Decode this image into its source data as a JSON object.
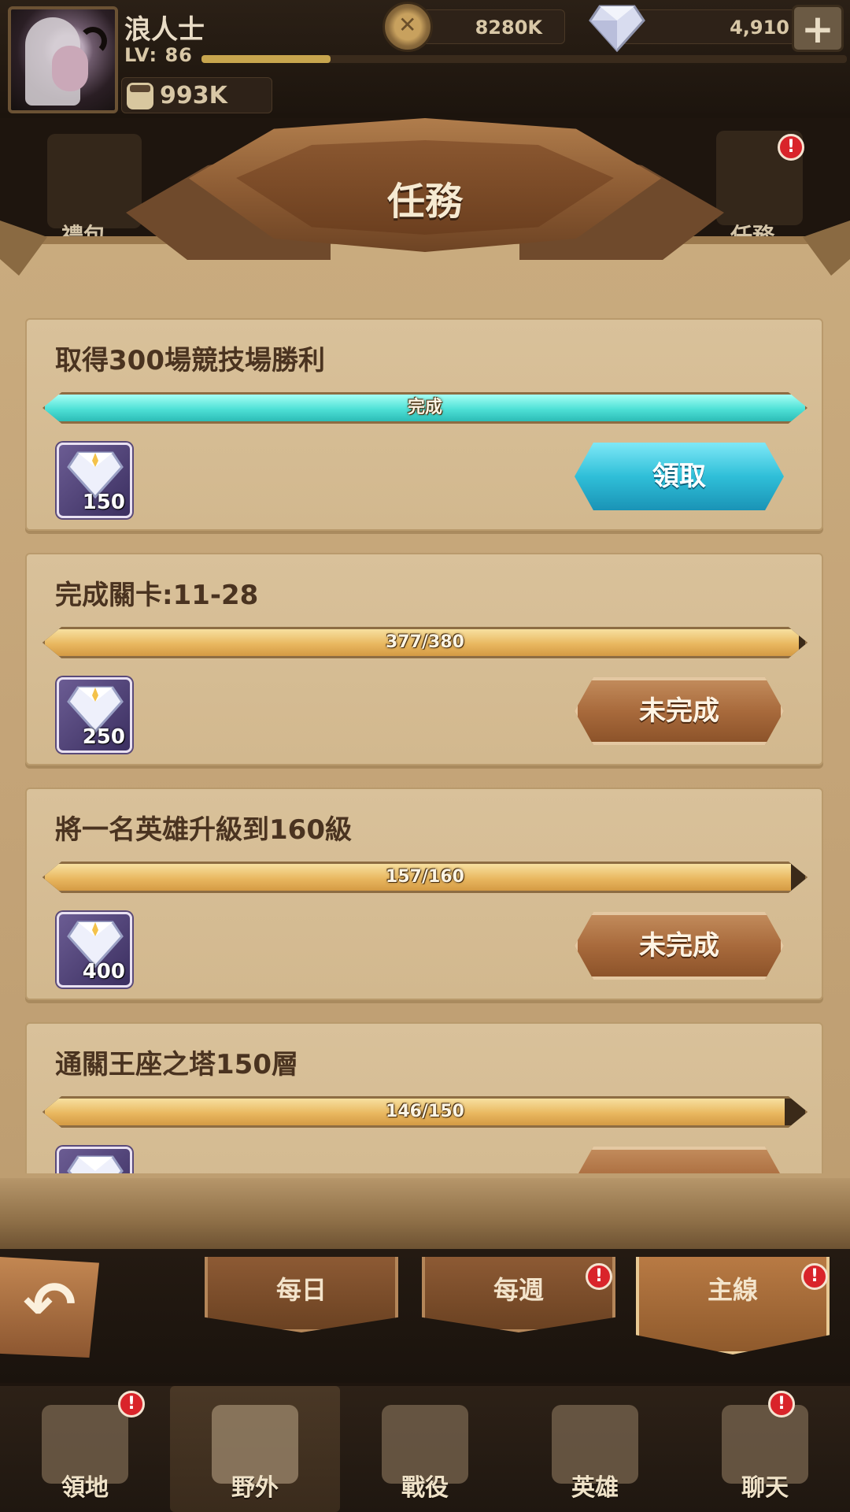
{
  "player": {
    "name": "浪人士",
    "level_label": "LV: 86",
    "xp_fraction": 0.2,
    "power": "993K"
  },
  "currency": {
    "gold": "8280K",
    "gems": "4,910"
  },
  "shortcuts": {
    "left_label": "禮包",
    "right_label": "任務"
  },
  "panel": {
    "title": "任務"
  },
  "quests": [
    {
      "title": "取得300場競技場勝利",
      "progress_text": "完成",
      "progress_fraction": 1.0,
      "completed": true,
      "reward_qty": "150",
      "button_label": "領取"
    },
    {
      "title": "完成關卡:11-28",
      "progress_text": "377/380",
      "progress_fraction": 0.9921,
      "completed": false,
      "reward_qty": "250",
      "button_label": "未完成"
    },
    {
      "title": "將一名英雄升級到160級",
      "progress_text": "157/160",
      "progress_fraction": 0.9813,
      "completed": false,
      "reward_qty": "400",
      "button_label": "未完成"
    },
    {
      "title": "通關王座之塔150層",
      "progress_text": "146/150",
      "progress_fraction": 0.9733,
      "completed": false,
      "reward_qty": "",
      "button_label": ""
    }
  ],
  "tabs": [
    {
      "label": "每日",
      "alert": false
    },
    {
      "label": "每週",
      "alert": true
    },
    {
      "label": "主線",
      "alert": true,
      "active": true
    }
  ],
  "nav": [
    {
      "label": "領地",
      "icon": "castle-icon",
      "alert": true
    },
    {
      "label": "野外",
      "icon": "scroll-map-icon",
      "active": true
    },
    {
      "label": "戰役",
      "icon": "sword-shield-icon"
    },
    {
      "label": "英雄",
      "icon": "helmet-icon"
    },
    {
      "label": "聊天",
      "icon": "chat-bubble-icon",
      "alert": true
    }
  ],
  "colors": {
    "parchment": "#c9ab7e",
    "complete_bar": "#4ee0d6",
    "progress_bar": "#e9b860",
    "claim_button": "#2fbfd8",
    "locked_button": "#a86a3c",
    "alert": "#d9242a"
  }
}
